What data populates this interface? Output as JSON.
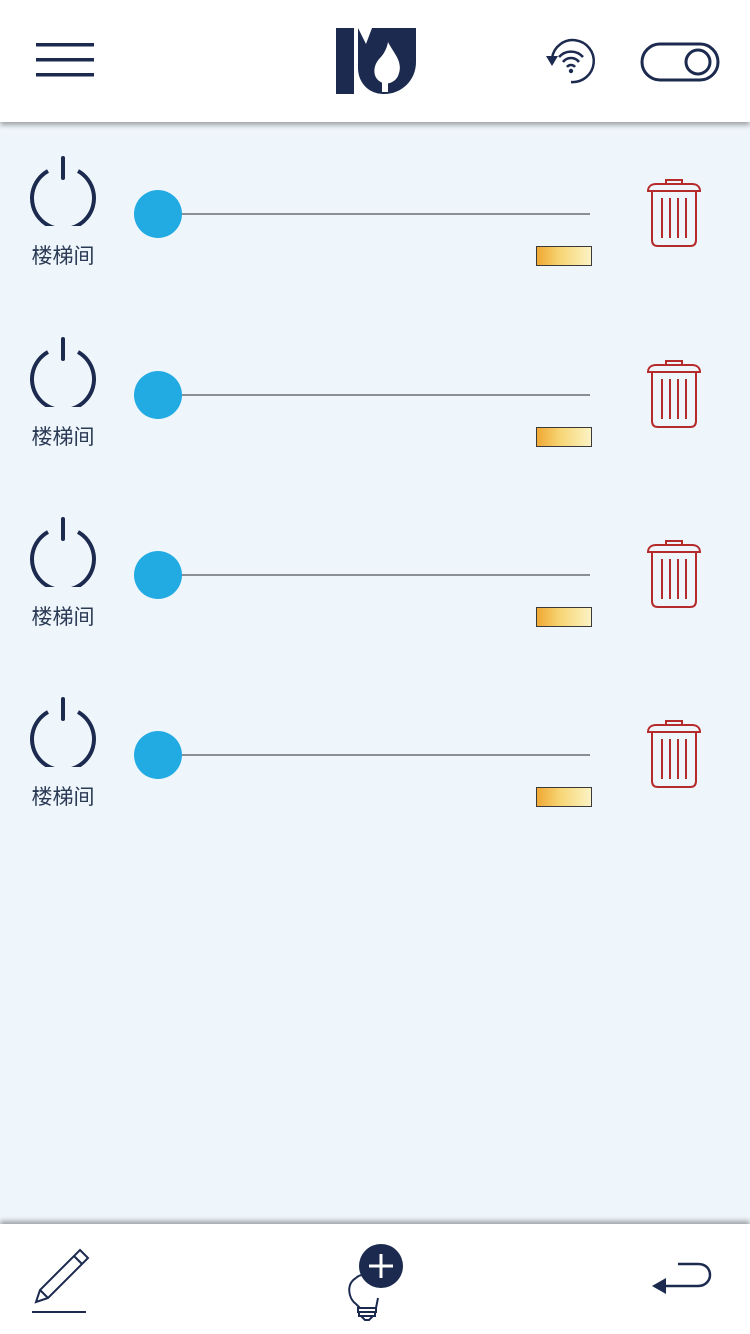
{
  "header": {
    "menu_icon": "hamburger-menu-icon",
    "logo_icon": "brand-logo",
    "wifi_icon": "wifi-refresh-icon",
    "toggle_icon": "toggle-switch-icon"
  },
  "devices": [
    {
      "label": "楼梯间",
      "power_icon": "power-icon",
      "brightness": 0,
      "delete_icon": "trash-icon"
    },
    {
      "label": "楼梯间",
      "power_icon": "power-icon",
      "brightness": 0,
      "delete_icon": "trash-icon"
    },
    {
      "label": "楼梯间",
      "power_icon": "power-icon",
      "brightness": 0,
      "delete_icon": "trash-icon"
    },
    {
      "label": "楼梯间",
      "power_icon": "power-icon",
      "brightness": 0,
      "delete_icon": "trash-icon"
    }
  ],
  "footer": {
    "edit_icon": "pencil-icon",
    "add_icon": "add-light-bulb-icon",
    "back_icon": "return-arrow-icon"
  },
  "colors": {
    "primary_dark": "#1b2a4e",
    "slider_thumb": "#22abe2",
    "delete_red": "#b52a2a",
    "background": "#eff6fb"
  }
}
